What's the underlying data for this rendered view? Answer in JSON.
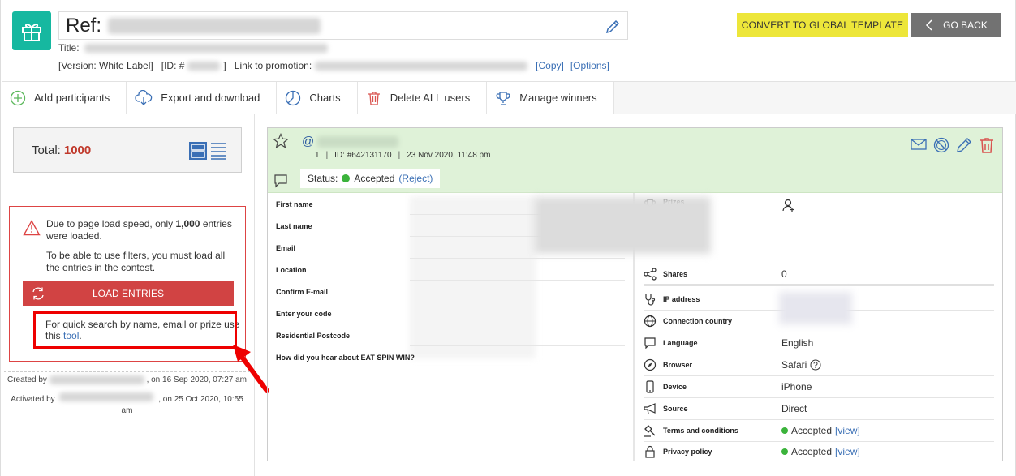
{
  "header": {
    "ref_label": "Ref:",
    "title_label": "Title:",
    "version": "[Version: White Label]",
    "id_label": "[ID: #",
    "id_close": "]",
    "link_label": "Link to promotion:",
    "copy_link": "[Copy]",
    "options_link": "[Options]",
    "convert_button": "CONVERT TO GLOBAL TEMPLATE",
    "back_button": "GO BACK"
  },
  "toolbar": {
    "items": [
      {
        "label": "Add participants",
        "icon": "add-circle-icon"
      },
      {
        "label": "Export and download",
        "icon": "cloud-download-icon"
      },
      {
        "label": "Charts",
        "icon": "pie-chart-icon"
      },
      {
        "label": "Delete ALL users",
        "icon": "trash-icon"
      },
      {
        "label": "Manage winners",
        "icon": "trophy-icon"
      }
    ]
  },
  "sidebar": {
    "total_label": "Total:",
    "total_value": "1000",
    "warning_line1_a": "Due to page load speed, only ",
    "warning_line1_b": "1,000",
    "warning_line1_c": " entries were loaded.",
    "warning_line2": "To be able to use filters, you must load all the entries in the contest.",
    "load_button": "LOAD ENTRIES",
    "quick_search_text": "For quick search by name, email or prize use this ",
    "quick_search_link": "tool",
    "quick_search_end": ".",
    "created_prefix": "Created by",
    "created_suffix": ", on 16 Sep 2020, 07:27 am",
    "activated_prefix": "Activated by",
    "activated_suffix": ", on 25 Oct 2020, 10:55 am"
  },
  "entry": {
    "at_sign": "@",
    "number": "1",
    "id": "ID: #642131170",
    "date": "23 Nov 2020, 11:48 pm",
    "status_label": "Status:",
    "status_value": "Accepted",
    "reject_link": "(Reject)",
    "status_color": "#3bb33b",
    "fields": [
      {
        "label": "First name"
      },
      {
        "label": "Last name"
      },
      {
        "label": "Email"
      },
      {
        "label": "Location"
      },
      {
        "label": "Confirm E-mail"
      },
      {
        "label": "Enter your code"
      },
      {
        "label": "Residential Postcode"
      },
      {
        "label": "How did you hear about EAT SPIN WIN?"
      }
    ],
    "details": {
      "prizes": "Prizes",
      "shares_label": "Shares",
      "shares_value": "0",
      "ip_label": "IP address",
      "country_label": "Connection country",
      "language_label": "Language",
      "language_value": "English",
      "browser_label": "Browser",
      "browser_value": "Safari",
      "device_label": "Device",
      "device_value": "iPhone",
      "source_label": "Source",
      "source_value": "Direct",
      "terms_label": "Terms and conditions",
      "terms_value": "Accepted",
      "privacy_label": "Privacy policy",
      "privacy_value": "Accepted",
      "view_link": "[view]"
    }
  },
  "colors": {
    "logo": "#16b8a0",
    "convert": "#ede63a",
    "back": "#727272",
    "load": "#d14343",
    "accent_red": "#c0392b",
    "link": "#3a6fb5",
    "entry_head": "#dff2d8"
  }
}
